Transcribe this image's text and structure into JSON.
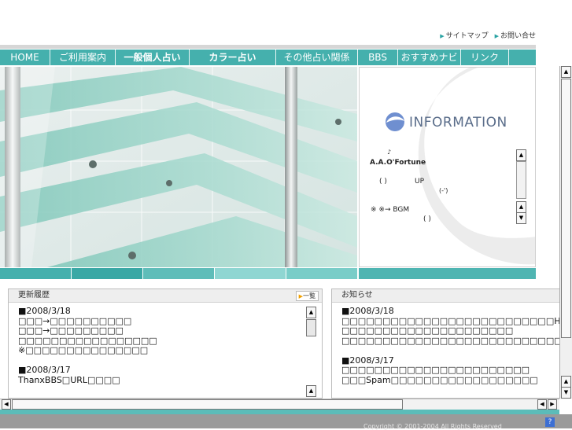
{
  "toplinks": {
    "sitemap": "サイトマップ",
    "contact": "お問い合せ"
  },
  "nav": [
    "HOME",
    "ご利用案内",
    "一般個人占い",
    "カラー占い",
    "その他占い関係",
    "BBS",
    "おすすめナビ",
    "リンク"
  ],
  "info": {
    "title": "INFORMATION",
    "note": "♪",
    "heading": "A.A.O'Fortune",
    "line1a": "( )",
    "line1b": "UP",
    "line2": "(-')",
    "line3": "※ ※→ BGM",
    "line4": "(     )"
  },
  "updates": {
    "title": "更新履歴",
    "list_button": "一覧",
    "lines": [
      "■2008/3/18",
      "□□□→□□□□□□□□□□",
      "□□□→□□□□□□□□□",
      "□□□□□□□□□□□□□□□□□",
      "※□□□□□□□□□□□□□□□",
      "",
      "■2008/3/17",
      "ThanxBBS□URL□□□□"
    ]
  },
  "news": {
    "title": "お知らせ",
    "lines": [
      "■2008/3/18",
      "□□□□□□□□□□□□□□□□□□□□□□□□□□HTML□□□□□□□□□□□□□□Uplo",
      "□□□□□□□□□□□□□□□□□□□□□",
      "□□□□□□□□□□□□□□□□□□□□□□□□□□□□□□□□□□□□□□□□□□□□□□□□□□",
      "",
      "■2008/3/17",
      "□□□□□□□□□□□□□□□□□□□□□□□",
      "□□□Spam□□□□□□□□□□□□□□□□□□"
    ]
  },
  "footer": {
    "copyright": "Copyright © 2001-2004     All Rights Reserved",
    "help": "?"
  },
  "colors": {
    "teal": "#45b0ad",
    "light_teal": "#8fd6d2",
    "footer_gray": "#9a9a9a"
  }
}
